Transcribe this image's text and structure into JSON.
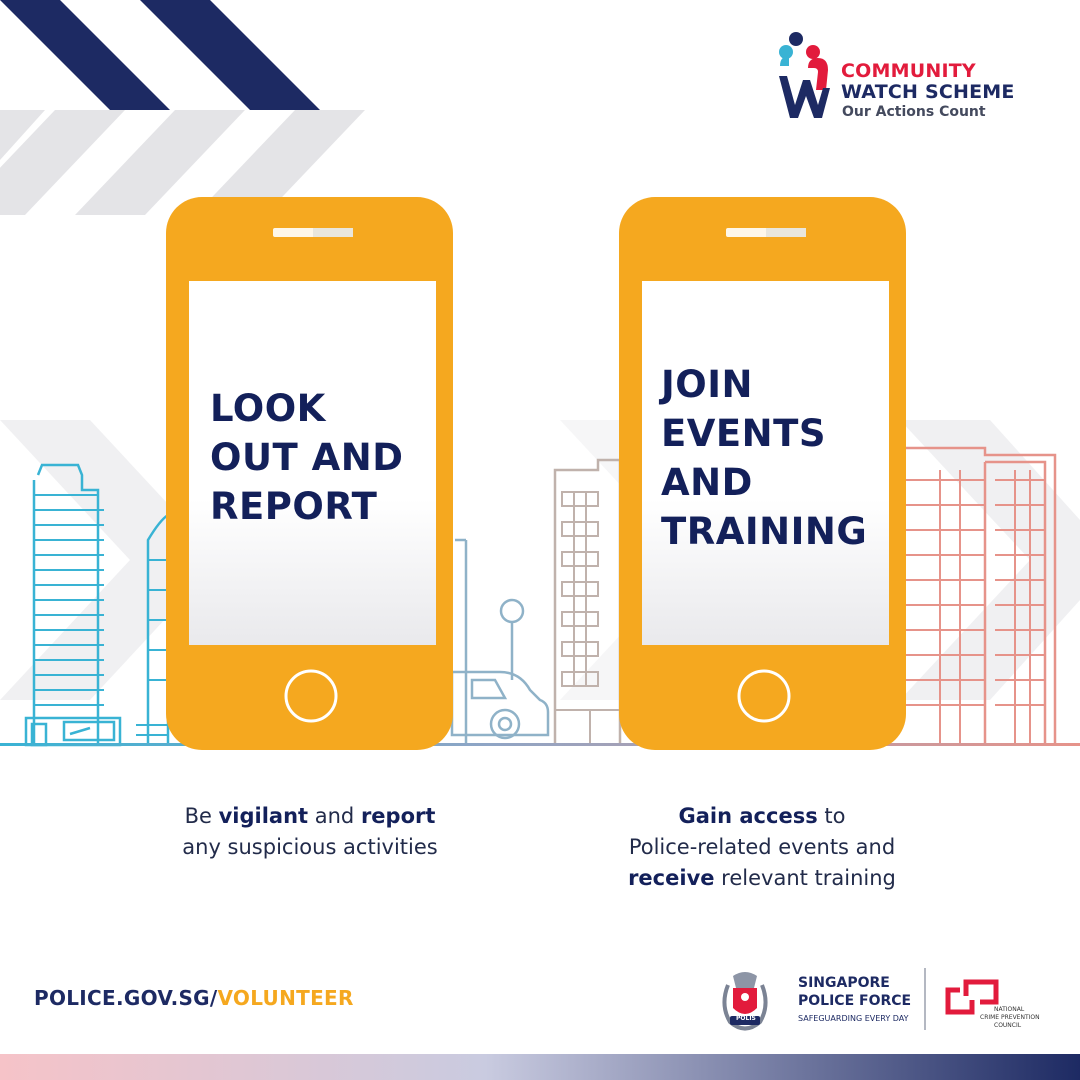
{
  "cws_logo": {
    "line1": "COMMUNITY",
    "line2": "WATCH SCHEME",
    "tagline": "Our Actions Count"
  },
  "phones": [
    {
      "lines": [
        "LOOK",
        "OUT AND",
        "REPORT"
      ]
    },
    {
      "lines": [
        "JOIN",
        "EVENTS",
        "AND",
        "TRAINING"
      ]
    }
  ],
  "captions": {
    "left": {
      "p1": "Be ",
      "b1": "vigilant",
      "p2": " and ",
      "b2": "report",
      "line2": "any suspicious activities"
    },
    "right": {
      "b1": "Gain access",
      "p1": " to",
      "line2": "Police-related events and",
      "b2": "receive",
      "p2": " relevant training"
    }
  },
  "footer": {
    "url_main": "POLICE.GOV.SG/",
    "url_highlight": "VOLUNTEER",
    "spf_line1": "SINGAPORE",
    "spf_line2": "POLICE FORCE",
    "spf_tagline": "SAFEGUARDING EVERY DAY",
    "spf_crest_text": "POLIS",
    "ncpc_line1": "NATIONAL",
    "ncpc_line2": "CRIME PREVENTION",
    "ncpc_line3": "COUNCIL"
  },
  "colors": {
    "navy": "#1d2a63",
    "phone": "#f5a81f",
    "red": "#e21b3c",
    "blue_building": "#39b3d4",
    "pink_building": "#e6938a",
    "grey_building": "#c0b2ac"
  }
}
